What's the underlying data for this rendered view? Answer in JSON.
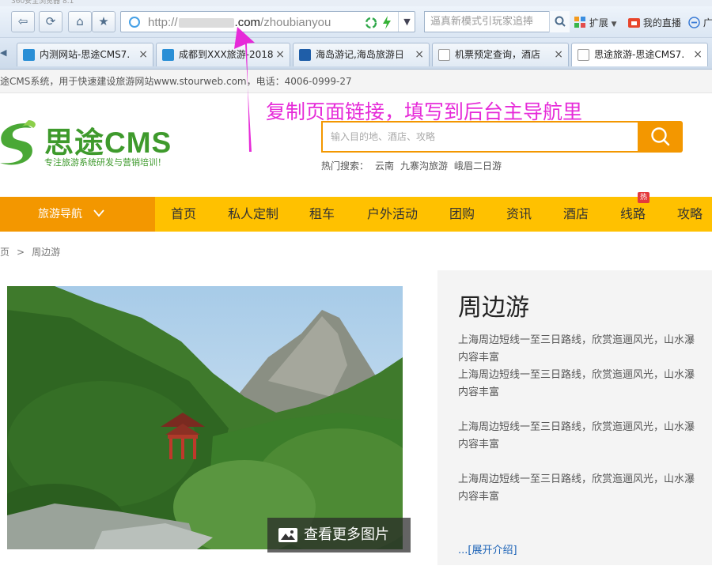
{
  "browser": {
    "title_fragment": "360安全浏览器 8.1",
    "url": {
      "scheme": "http://",
      "domain_tail": ".com",
      "path": "/zhoubianyou"
    },
    "search_placeholder": "逼真新模式引玩家追捧",
    "extensions": [
      "扩展",
      "我的直播",
      "广"
    ],
    "tabs": [
      {
        "label": "内测网站-思途CMS7.",
        "icon_color": "#2a8fd6"
      },
      {
        "label": "成都到XXX旅游-2018",
        "icon_color": "#2a8fd6"
      },
      {
        "label": "海岛游记,海岛旅游日",
        "icon_color": "#1f5ea8"
      },
      {
        "label": "机票预定查询，酒店",
        "icon_color": "#999999"
      },
      {
        "label": "思途旅游-思途CMS7.",
        "icon_color": "#999999"
      }
    ],
    "tab_close": "×"
  },
  "site": {
    "notice": "途CMS系统，用于快速建设旅游网站www.stourweb.com，电话：4006-0999-27",
    "logo": {
      "name": "思途CMS",
      "slogan": "专注旅游系统研发与营销培训！"
    },
    "search_placeholder": "输入目的地、酒店、攻略",
    "hot_label": "热门搜索：",
    "hot_terms": [
      "云南",
      "九寨沟旅游",
      "峨眉二日游"
    ],
    "annotation": "复制页面链接，填写到后台主导航里",
    "nav_guide": "旅游导航",
    "nav": [
      "首页",
      "私人定制",
      "租车",
      "户外活动",
      "团购",
      "资讯",
      "酒店",
      "线路",
      "攻略"
    ],
    "hot_badge": "热",
    "breadcrumb": [
      "页",
      ">",
      "周边游"
    ],
    "more_photos": "查看更多图片",
    "title": "周边游",
    "desc_line1": "上海周边短线一至三日路线，欣赏迤逦风光，山水瀑",
    "desc_line2": "内容丰富",
    "expand": "...[展开介绍]"
  },
  "colors": {
    "accent_orange": "#f39700",
    "nav_yellow": "#ffc100",
    "logo_green": "#3e9a2c",
    "annotation_magenta": "#e62ad8"
  },
  "icons": [
    "back-icon",
    "refresh-icon",
    "home-icon",
    "star-icon",
    "search-icon",
    "image-icon",
    "chevron-down-icon",
    "close-icon"
  ]
}
